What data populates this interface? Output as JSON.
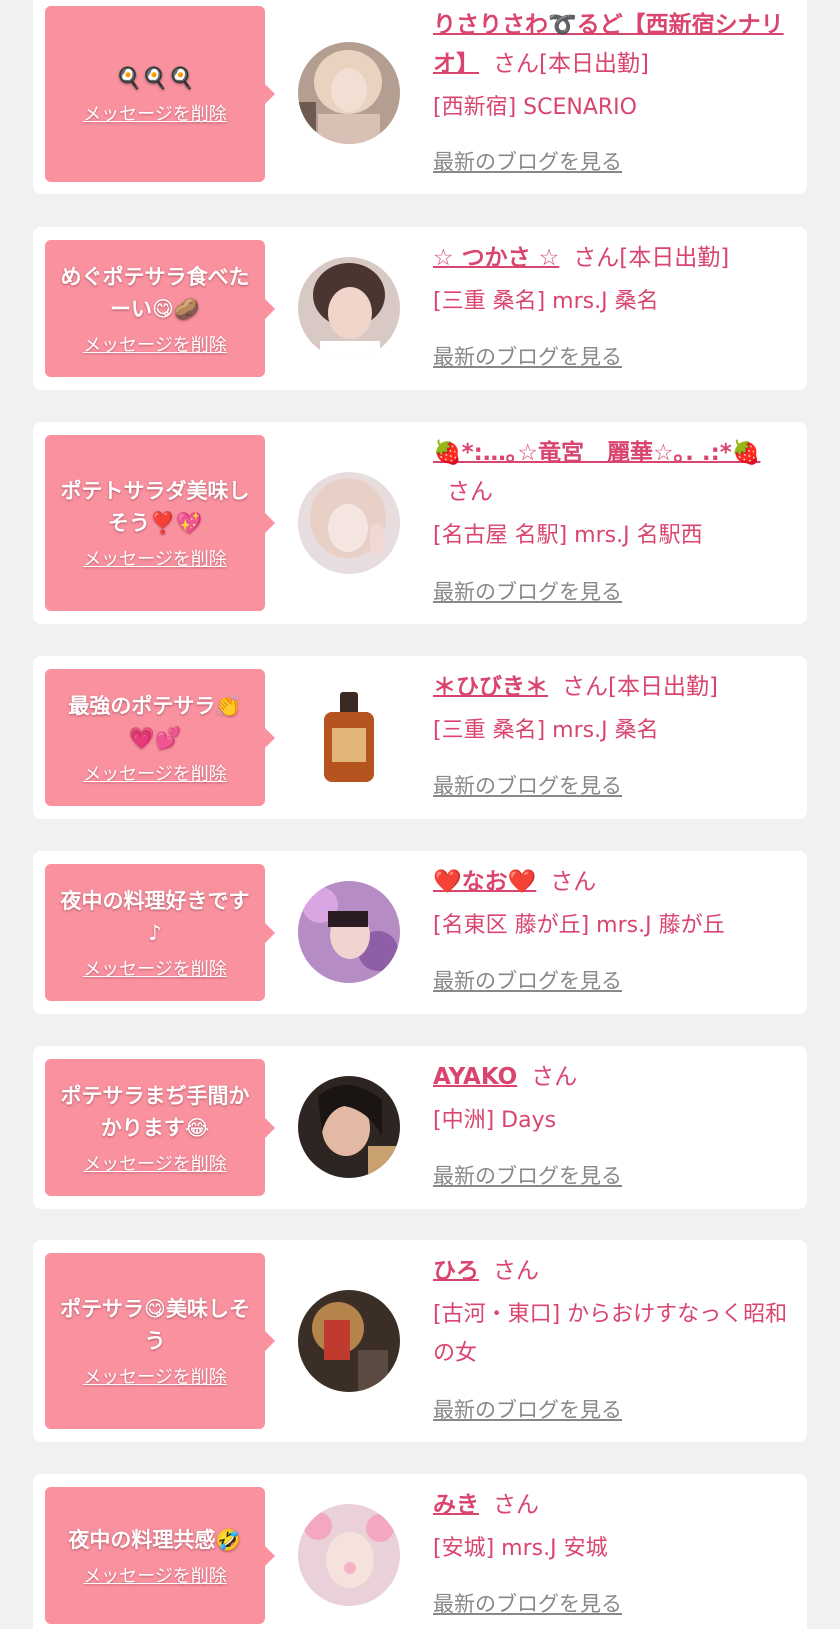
{
  "common": {
    "delete_label": "メッセージを削除",
    "blog_label": "最新のブログを見る",
    "san_label": "さん"
  },
  "messages": [
    {
      "bubble": "🍳🍳🍳",
      "name": "りさりさわ➰るど【西新宿シナリオ】",
      "status": "さん[本日出勤]",
      "shop": "[西新宿] SCENARIO",
      "avatar_icon": "avatar-photo-blonde-woman"
    },
    {
      "bubble": "めぐポテサラ食べたーい😋🥔",
      "name": "☆ つかさ ☆",
      "status": "さん[本日出勤]",
      "shop": "[三重 桑名] mrs.J 桑名",
      "avatar_icon": "avatar-photo-short-hair-woman"
    },
    {
      "bubble": "ポテトサラダ美味しそう❣️💖",
      "name": "🍓*:…｡☆竜宮　麗華☆｡. .:*🍓",
      "status": "さん",
      "shop": "[名古屋 名駅] mrs.J 名駅西",
      "avatar_icon": "avatar-photo-peace-sign-woman"
    },
    {
      "bubble": "最強のポテサラ👏💗💕",
      "name": "＊ひびき＊",
      "status": "さん[本日出勤]",
      "shop": "[三重 桑名] mrs.J 桑名",
      "avatar_icon": "avatar-photo-whisky-bottle"
    },
    {
      "bubble": "夜中の料理好きです♪",
      "name": "❤️なお❤️",
      "status": "さん",
      "shop": "[名東区 藤が丘] mrs.J 藤が丘",
      "avatar_icon": "avatar-photo-flowers-woman"
    },
    {
      "bubble": "ポテサラまぢ手間かかります😂",
      "name": "AYAKO",
      "status": "さん",
      "shop": "[中洲] Days",
      "avatar_icon": "avatar-photo-dark-hair-woman"
    },
    {
      "bubble": "ポテサラ😋美味しそう",
      "name": "ひろ",
      "status": "さん",
      "shop": "[古河・東口] からおけすなっく昭和の女",
      "avatar_icon": "avatar-photo-bar-interior"
    },
    {
      "bubble": "夜中の料理共感🤣",
      "name": "みき",
      "status": "さん",
      "shop": "[安城] mrs.J 安城",
      "avatar_icon": "avatar-photo-bunny-filter-woman"
    }
  ],
  "colors": {
    "page_bg": "#f1f1f1",
    "card_bg": "#ffffff",
    "bubble_bg": "#f9919f",
    "accent_pink": "#d9456f",
    "link_gray": "#888888"
  }
}
